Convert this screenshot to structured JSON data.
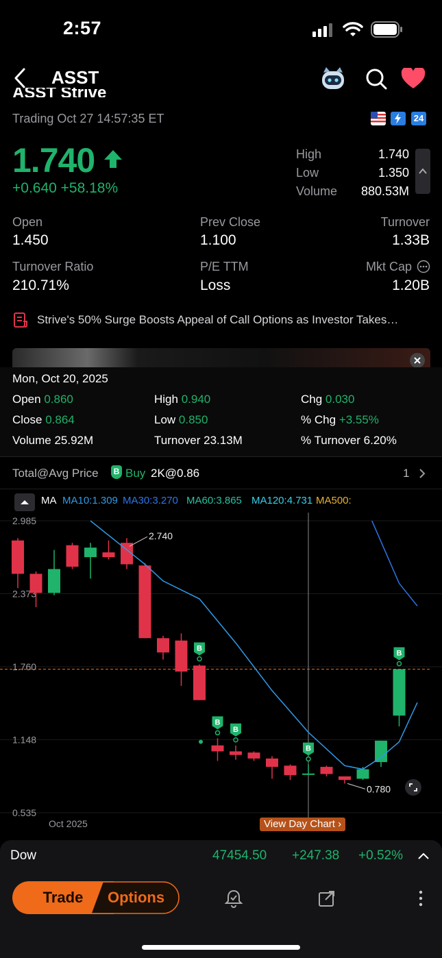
{
  "status": {
    "time": "2:57"
  },
  "nav": {
    "title": "ASST"
  },
  "header": {
    "truncated_title": "ASST  Strive",
    "trading_status": "Trading Oct 27 14:57:35 ET",
    "badge_24": "24",
    "price": "1.740",
    "change": "+0.640 +58.18%",
    "high_label": "High",
    "high_value": "1.740",
    "low_label": "Low",
    "low_value": "1.350",
    "volume_label": "Volume",
    "volume_value": "880.53M"
  },
  "stats": {
    "open_label": "Open",
    "open_value": "1.450",
    "prev_close_label": "Prev Close",
    "prev_close_value": "1.100",
    "turnover_label": "Turnover",
    "turnover_value": "1.33B",
    "turnover_ratio_label": "Turnover Ratio",
    "turnover_ratio_value": "210.71%",
    "pe_label": "P/E TTM",
    "pe_value": "Loss",
    "mktcap_label": "Mkt Cap",
    "mktcap_value": "1.20B"
  },
  "news": {
    "headline": "Strive's 50% Surge Boosts Appeal of Call Options as Investor Takes…"
  },
  "tooltip": {
    "date": "Mon, Oct 20, 2025",
    "open_label": "Open",
    "open_value": "0.860",
    "high_label": "High",
    "high_value": "0.940",
    "chg_label": "Chg",
    "chg_value": "0.030",
    "close_label": "Close",
    "close_value": "0.864",
    "low_label": "Low",
    "low_value": "0.850",
    "pchg_label": "% Chg",
    "pchg_value": "+3.55%",
    "volume_label": "Volume",
    "volume_value": "25.92M",
    "turnover_label": "Turnover",
    "turnover_value": "23.13M",
    "pturnover_label": "% Turnover",
    "pturnover_value": "6.20%"
  },
  "position": {
    "label": "Total@Avg Price",
    "badge": "B",
    "side": "Buy",
    "detail": "2K@0.86",
    "count": "1"
  },
  "ma_bar": {
    "ma_label": "MA",
    "ma10": "MA10:1.309",
    "ma30": "MA30:3.270",
    "ma60": "MA60:3.865",
    "ma120": "MA120:4.731",
    "ma500": "MA500:"
  },
  "colors": {
    "up": "#1fb36b",
    "down": "#e0334a",
    "accent": "#ef6a19",
    "ma_line": "#2f8fd8",
    "bg": "#000000"
  },
  "chart_data": {
    "type": "candlestick",
    "y_ticks": [
      "2.985",
      "2.373",
      "1.760",
      "1.148",
      "0.535"
    ],
    "ylim": [
      0.535,
      2.985
    ],
    "x_tick_label": "Oct 2025",
    "max_annotation": "2.740",
    "min_annotation": "0.780",
    "last_price_line": 1.74,
    "view_day_label": "View Day Chart",
    "candles": [
      {
        "o": 2.82,
        "c": 2.54,
        "h": 2.84,
        "l": 2.42
      },
      {
        "o": 2.54,
        "c": 2.38,
        "h": 2.56,
        "l": 2.26
      },
      {
        "o": 2.38,
        "c": 2.58,
        "h": 2.74,
        "l": 2.36
      },
      {
        "o": 2.78,
        "c": 2.6,
        "h": 2.8,
        "l": 2.58
      },
      {
        "o": 2.68,
        "c": 2.76,
        "h": 2.8,
        "l": 2.5
      },
      {
        "o": 2.72,
        "c": 2.68,
        "h": 2.82,
        "l": 2.66
      },
      {
        "o": 2.8,
        "c": 2.62,
        "h": 2.84,
        "l": 2.58
      },
      {
        "o": 2.61,
        "c": 2.0,
        "h": 2.63,
        "l": 2.0
      },
      {
        "o": 2.0,
        "c": 1.88,
        "h": 2.02,
        "l": 1.82
      },
      {
        "o": 1.98,
        "c": 1.72,
        "h": 2.04,
        "l": 1.6
      },
      {
        "o": 1.77,
        "c": 1.48,
        "h": 1.78,
        "l": 1.48
      },
      {
        "o": 1.1,
        "c": 1.05,
        "h": 1.16,
        "l": 0.97
      },
      {
        "o": 1.05,
        "c": 1.02,
        "h": 1.1,
        "l": 0.98
      },
      {
        "o": 1.04,
        "c": 0.99,
        "h": 1.05,
        "l": 0.97
      },
      {
        "o": 0.99,
        "c": 0.92,
        "h": 1.01,
        "l": 0.82
      },
      {
        "o": 0.93,
        "c": 0.85,
        "h": 0.94,
        "l": 0.81
      },
      {
        "o": 0.86,
        "c": 0.864,
        "h": 0.94,
        "l": 0.85
      },
      {
        "o": 0.92,
        "c": 0.86,
        "h": 0.93,
        "l": 0.84
      },
      {
        "o": 0.84,
        "c": 0.81,
        "h": 0.84,
        "l": 0.78
      },
      {
        "o": 0.82,
        "c": 0.9,
        "h": 0.92,
        "l": 0.81
      },
      {
        "o": 0.96,
        "c": 1.14,
        "h": 1.14,
        "l": 0.92
      },
      {
        "o": 1.35,
        "c": 1.74,
        "h": 1.74,
        "l": 1.26
      }
    ],
    "ma_series": [
      {
        "name": "MA10",
        "points": [
          [
            4,
            2.985
          ],
          [
            7,
            2.62
          ],
          [
            8,
            2.48
          ],
          [
            10,
            2.33
          ],
          [
            12,
            1.96
          ],
          [
            14,
            1.56
          ],
          [
            16,
            1.21
          ],
          [
            18,
            0.93
          ],
          [
            19,
            0.9
          ],
          [
            20,
            1.0
          ],
          [
            21,
            1.13
          ],
          [
            22,
            1.46
          ]
        ]
      },
      {
        "name": "MA30",
        "points": [
          [
            19.5,
            2.985
          ],
          [
            21,
            2.46
          ],
          [
            22,
            2.27
          ]
        ]
      }
    ],
    "buy_markers": [
      10,
      11,
      12,
      16,
      21
    ]
  },
  "ticker": {
    "name": "Dow",
    "value": "47454.50",
    "change": "+247.38",
    "pct": "+0.52%"
  },
  "actions": {
    "trade": "Trade",
    "options": "Options"
  }
}
